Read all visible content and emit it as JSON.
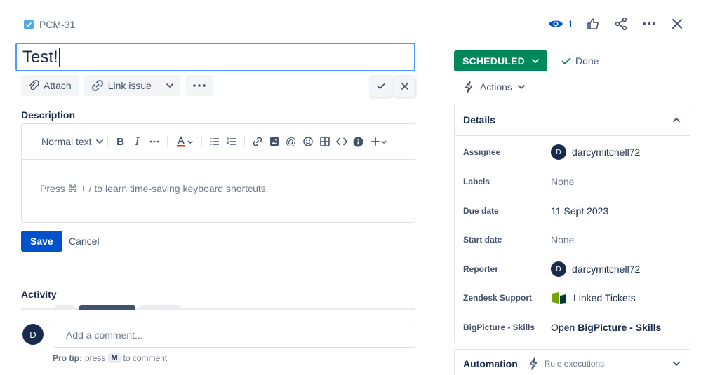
{
  "header": {
    "issue_key": "PCM-31",
    "watch_count": "1"
  },
  "title": {
    "value": "Test!"
  },
  "toolbar": {
    "attach_label": "Attach",
    "link_issue_label": "Link issue"
  },
  "description": {
    "label": "Description",
    "text_style": "Normal text",
    "placeholder": "Press ⌘ + / to learn time-saving keyboard shortcuts.",
    "save_label": "Save",
    "cancel_label": "Cancel"
  },
  "activity": {
    "label": "Activity",
    "avatar_initial": "D",
    "comment_placeholder": "Add a comment...",
    "protip_bold": "Pro tip:",
    "protip_pre": "press",
    "protip_key": "M",
    "protip_post": "to comment"
  },
  "status": {
    "label": "SCHEDULED",
    "done_label": "Done",
    "actions_label": "Actions",
    "color": "#00875a"
  },
  "details": {
    "heading": "Details",
    "rows": [
      {
        "label": "Assignee",
        "value": "darcymitchell72",
        "avatar": "D"
      },
      {
        "label": "Labels",
        "value": "None"
      },
      {
        "label": "Due date",
        "value": "11 Sept 2023"
      },
      {
        "label": "Start date",
        "value": "None"
      },
      {
        "label": "Reporter",
        "value": "darcymitchell72",
        "avatar": "D"
      },
      {
        "label": "Zendesk Support",
        "value": "Linked Tickets"
      },
      {
        "label": "BigPicture - Skills",
        "value_pre": "Open",
        "value_bold": "BigPicture - Skills"
      }
    ]
  },
  "automation": {
    "label": "Automation",
    "rule_label": "Rule executions"
  },
  "colors": {
    "primary": "#0052cc",
    "focus": "#4c9aff",
    "text": "#172b4d"
  }
}
